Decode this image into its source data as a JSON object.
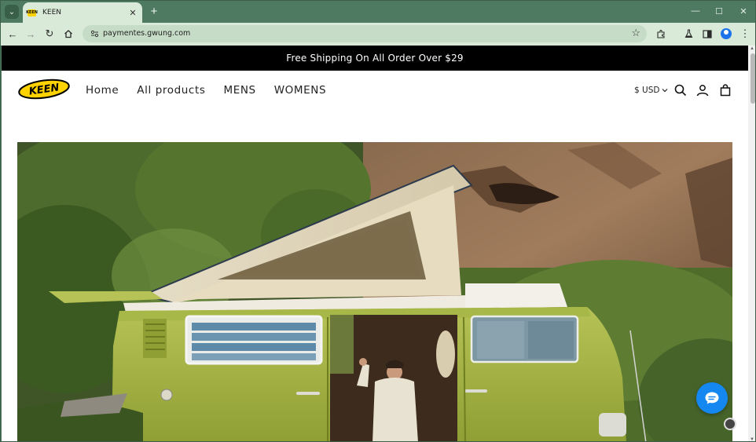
{
  "browser": {
    "tab": {
      "title": "KEEN",
      "favicon_label": "KEEN"
    },
    "url": "paymentes.gwung.com",
    "window_controls": {
      "minimize": "—",
      "maximize": "☐",
      "close": "✕"
    },
    "icons": [
      "tab-search-icon",
      "close-icon",
      "new-tab-icon",
      "back-icon",
      "forward-icon",
      "reload-icon",
      "home-icon",
      "site-info-icon",
      "bookmark-star-icon",
      "extensions-icon",
      "labs-icon",
      "sidebar-icon",
      "profile-icon",
      "menu-icon"
    ]
  },
  "site": {
    "announcement": "Free Shipping On All Order Over $29",
    "logo_text": "KEEN",
    "nav": [
      {
        "label": "Home"
      },
      {
        "label": "All products"
      },
      {
        "label": "MENS"
      },
      {
        "label": "WOMENS"
      }
    ],
    "currency": "$ USD",
    "header_icons": [
      "search-icon",
      "account-icon",
      "cart-icon"
    ]
  },
  "colors": {
    "browser_frame": "#4d7a60",
    "toolbar": "#d9ead9",
    "announcement_bg": "#000000",
    "logo_yellow": "#ffd200",
    "chat_button": "#1587f0"
  }
}
